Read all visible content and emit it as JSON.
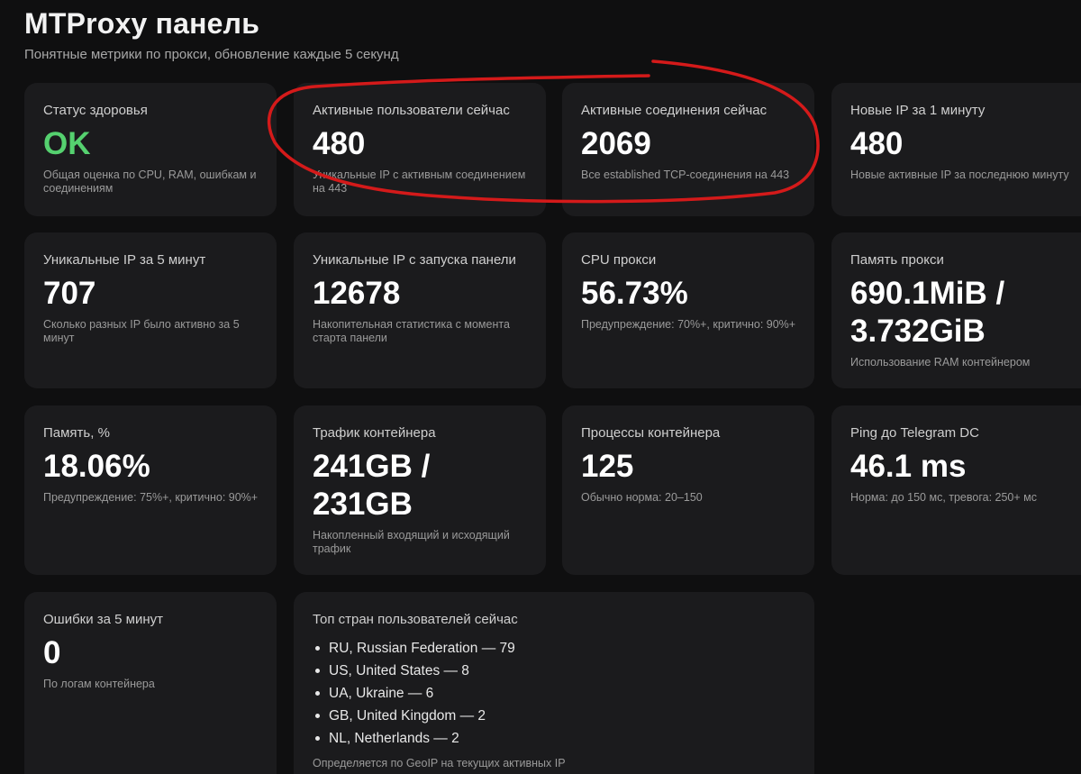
{
  "header": {
    "title": "MTProxy панель",
    "subtitle": "Понятные метрики по прокси, обновление каждые 5 секунд"
  },
  "cards": {
    "health": {
      "label": "Статус здоровья",
      "value": "OK",
      "hint": "Общая оценка по CPU, RAM, ошибкам и соединениям"
    },
    "active_users": {
      "label": "Активные пользователи сейчас",
      "value": "480",
      "hint": "Уникальные IP с активным соединением на 443"
    },
    "active_connections": {
      "label": "Активные соединения сейчас",
      "value": "2069",
      "hint": "Все established TCP-соединения на 443"
    },
    "new_ip": {
      "label": "Новые IP за 1 минуту",
      "value": "480",
      "hint": "Новые активные IP за последнюю минуту"
    },
    "unique_ip_5m": {
      "label": "Уникальные IP за 5 минут",
      "value": "707",
      "hint": "Сколько разных IP было активно за 5 минут"
    },
    "unique_ip_total": {
      "label": "Уникальные IP с запуска панели",
      "value": "12678",
      "hint": "Накопительная статистика с момента старта панели"
    },
    "cpu": {
      "label": "CPU прокси",
      "value": "56.73%",
      "hint": "Предупреждение: 70%+, критично: 90%+"
    },
    "memory": {
      "label": "Память прокси",
      "value_line1": "690.1MiB /",
      "value_line2": "3.732GiB",
      "hint": "Использование RAM контейнером"
    },
    "memory_pct": {
      "label": "Память, %",
      "value": "18.06%",
      "hint": "Предупреждение: 75%+, критично: 90%+"
    },
    "traffic": {
      "label": "Трафик контейнера",
      "value_line1": "241GB /",
      "value_line2": "231GB",
      "hint": "Накопленный входящий и исходящий трафик"
    },
    "processes": {
      "label": "Процессы контейнера",
      "value": "125",
      "hint": "Обычно норма: 20–150"
    },
    "ping": {
      "label": "Ping до Telegram DC",
      "value": "46.1 ms",
      "hint": "Норма: до 150 мс, тревога: 250+ мс"
    },
    "errors": {
      "label": "Ошибки за 5 минут",
      "value": "0",
      "hint": "По логам контейнера"
    },
    "countries": {
      "label": "Топ стран пользователей сейчас",
      "items": [
        "RU, Russian Federation — 79",
        "US, United States — 8",
        "UA, Ukraine — 6",
        "GB, United Kingdom — 2",
        "NL, Netherlands — 2"
      ],
      "hint": "Определяется по GeoIP на текущих активных IP"
    }
  },
  "colors": {
    "background": "#0f0f10",
    "card": "#1b1b1d",
    "ok": "#55d16f",
    "annotation": "#d41a1a"
  }
}
